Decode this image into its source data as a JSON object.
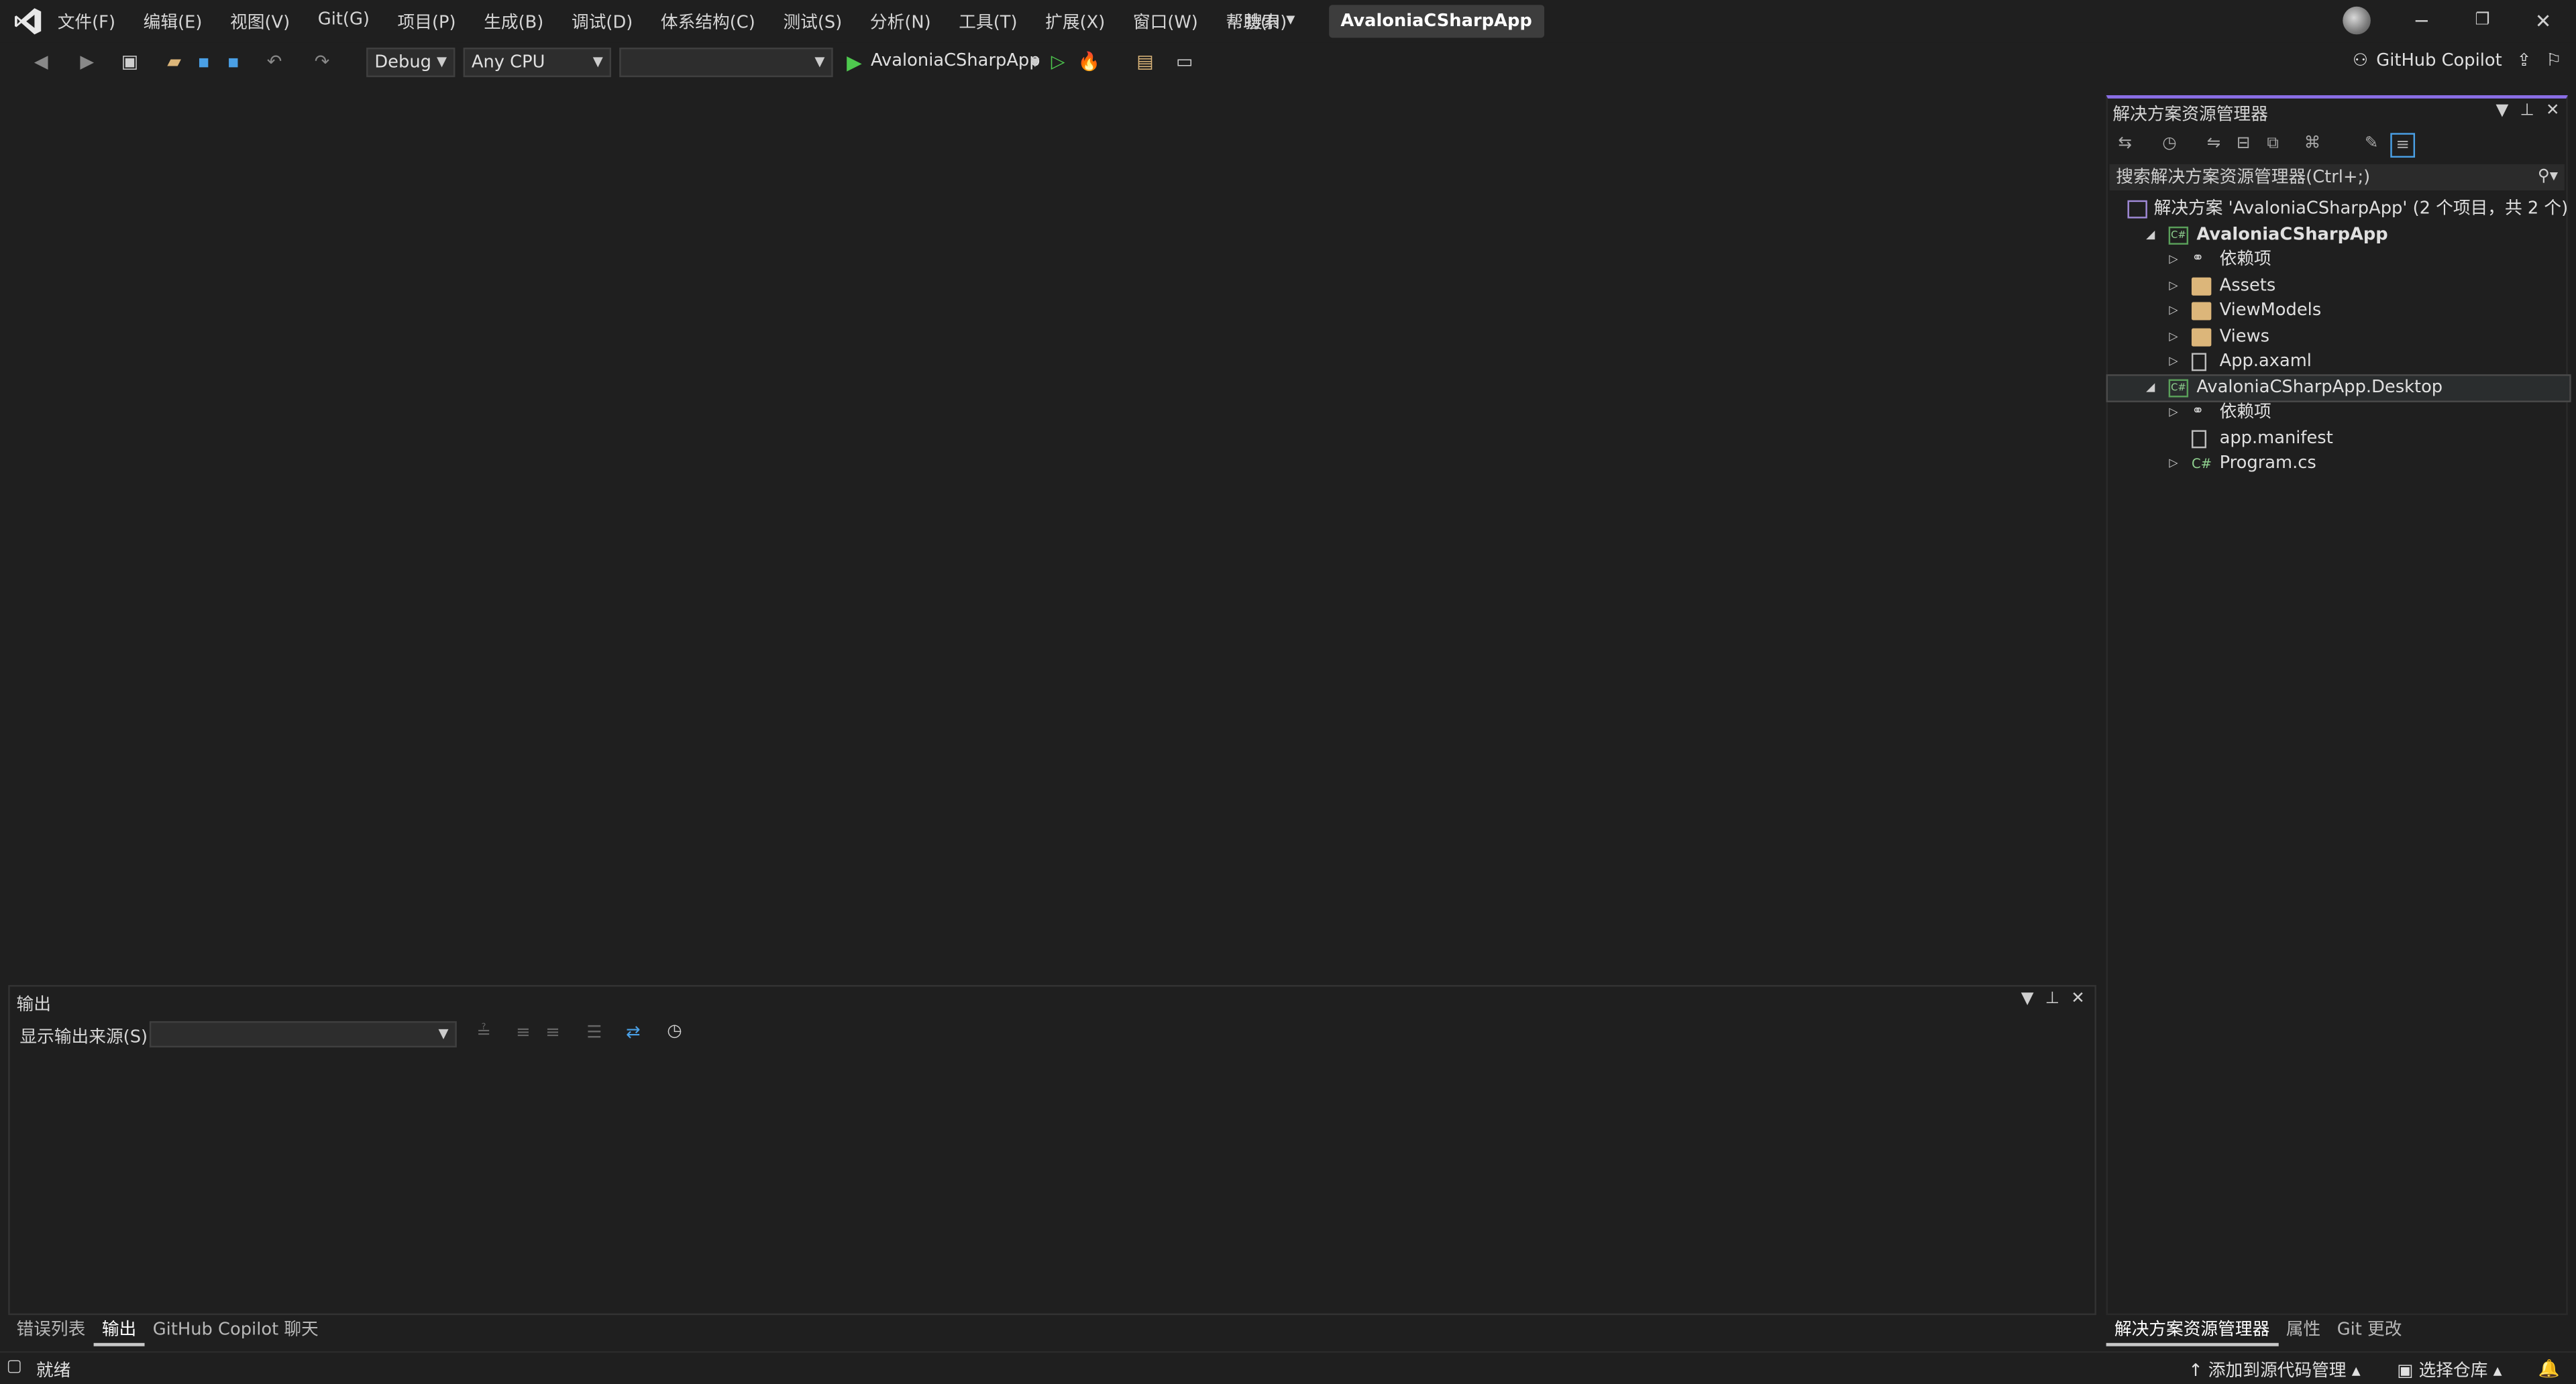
{
  "app": {
    "title": "AvaloniaCSharpApp"
  },
  "menu": {
    "items": [
      "文件(F)",
      "编辑(E)",
      "视图(V)",
      "Git(G)",
      "项目(P)",
      "生成(B)",
      "调试(D)",
      "体系结构(C)",
      "测试(S)",
      "分析(N)",
      "工具(T)",
      "扩展(X)",
      "窗口(W)",
      "帮助(H)"
    ],
    "search_label": "搜索"
  },
  "toolbar": {
    "configuration": "Debug",
    "platform": "Any CPU",
    "startup_target": "",
    "run_label": "AvaloniaCSharpApp",
    "copilot_label": "GitHub Copilot"
  },
  "output_panel": {
    "title": "输出",
    "source_label": "显示输出来源(S):",
    "source_value": ""
  },
  "bottom_tabs": [
    "错误列表",
    "输出",
    "GitHub Copilot 聊天"
  ],
  "solution_explorer": {
    "title": "解决方案资源管理器",
    "search_placeholder": "搜索解决方案资源管理器(Ctrl+;)",
    "tree": [
      {
        "label": "解决方案 'AvaloniaCSharpApp' (2 个项目，共 2 个)",
        "icon": "solution-icon"
      },
      {
        "label": "AvaloniaCSharpApp",
        "icon": "csharp-project-icon",
        "expanded": true,
        "bold": true
      },
      {
        "label": "依赖项",
        "icon": "dependencies-icon"
      },
      {
        "label": "Assets",
        "icon": "folder-icon"
      },
      {
        "label": "ViewModels",
        "icon": "folder-icon"
      },
      {
        "label": "Views",
        "icon": "folder-icon"
      },
      {
        "label": "App.axaml",
        "icon": "xaml-file-icon"
      },
      {
        "label": "AvaloniaCSharpApp.Desktop",
        "icon": "csharp-project-icon",
        "expanded": true,
        "selected": true
      },
      {
        "label": "依赖项",
        "icon": "dependencies-icon"
      },
      {
        "label": "app.manifest",
        "icon": "manifest-file-icon"
      },
      {
        "label": "Program.cs",
        "icon": "csharp-file-icon"
      }
    ]
  },
  "se_tabs": [
    "解决方案资源管理器",
    "属性",
    "Git 更改"
  ],
  "status": {
    "ready": "就绪",
    "add_source_control": "添加到源代码管理",
    "select_repo": "选择仓库"
  },
  "colors": {
    "background": "#1f1f1f",
    "accent": "#8a6ee6",
    "run_green": "#4ec94e",
    "folder": "#dcb67a"
  }
}
